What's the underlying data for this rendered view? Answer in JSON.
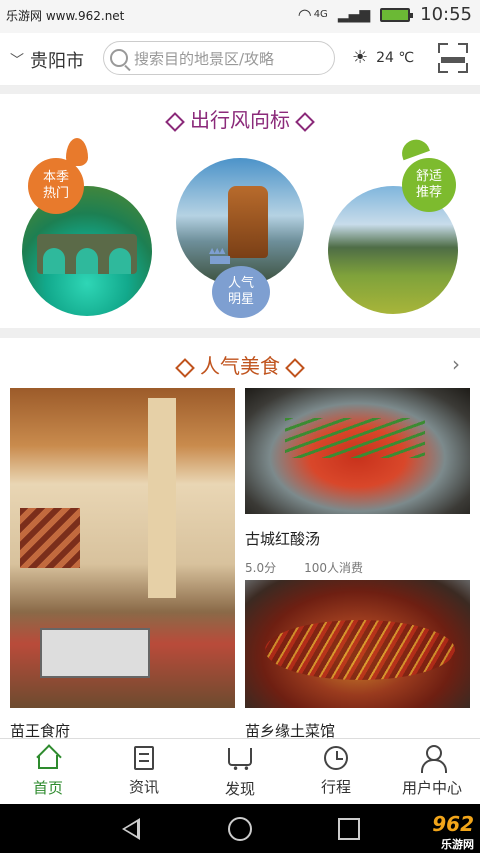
{
  "status": {
    "site": "乐游网 www.962.net",
    "network": "4G",
    "time": "10:55"
  },
  "header": {
    "city": "贵阳市",
    "search_placeholder": "搜索目的地景区/攻略",
    "temperature": "24 ℃"
  },
  "guide": {
    "title": "出行风向标",
    "badges": [
      {
        "label": "本季\n热门",
        "line1": "本季",
        "line2": "热门"
      },
      {
        "label": "人气\n明星",
        "line1": "人气",
        "line2": "明星"
      },
      {
        "label": "舒适\n推荐",
        "line1": "舒适",
        "line2": "推荐"
      }
    ]
  },
  "food": {
    "title": "人气美食",
    "items": [
      {
        "name": "苗王食府"
      },
      {
        "name": "古城红酸汤",
        "score": "5.0分",
        "consumers": "100人消费"
      },
      {
        "name": "苗乡缘土菜馆"
      }
    ]
  },
  "tabs": [
    {
      "label": "首页",
      "icon": "home-icon",
      "active": true
    },
    {
      "label": "资讯",
      "icon": "news-icon"
    },
    {
      "label": "发现",
      "icon": "cart-icon"
    },
    {
      "label": "行程",
      "icon": "itinerary-icon"
    },
    {
      "label": "用户中心",
      "icon": "user-icon"
    }
  ],
  "watermark": {
    "brand": "962",
    "sub": "乐游网"
  },
  "colors": {
    "accent": "#2e8b2e",
    "guide_title": "#8b2a7a",
    "food_title": "#c0531d"
  }
}
